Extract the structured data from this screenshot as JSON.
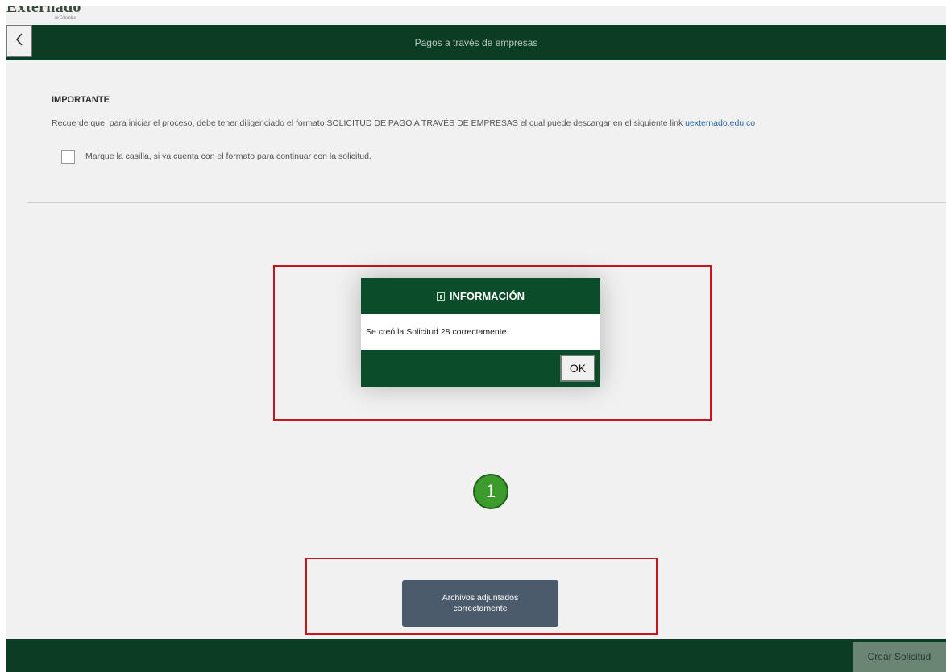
{
  "brand": {
    "name": "Externado",
    "subtitle": "de Colombia"
  },
  "header": {
    "title": "Pagos a través de empresas",
    "back_icon": "chevron-left-icon"
  },
  "content": {
    "section_title": "IMPORTANTE",
    "notice_text": "Recuerde que, para iniciar el proceso, debe tener diligenciado el formato SOLICITUD DE PAGO A TRAVÉS DE EMPRESAS el cual puede descargar en el siguiente link ",
    "notice_link": "uexternado.edu.co",
    "checkbox_label": "Marque la casilla, si ya cuenta con el formato para continuar con la solicitud.",
    "checkbox_checked": false
  },
  "dialog": {
    "title": "INFORMACIÓN",
    "icon": "info-icon",
    "message": "Se creó la Solicitud 28 correctamente",
    "ok_label": "OK"
  },
  "annotation": {
    "step_number": "1",
    "highlight_color": "#c8151b",
    "badge_color": "#3d9a2c"
  },
  "toast": {
    "message": "Archivos adjuntados correctamente"
  },
  "footer": {
    "create_label": "Crear Solicitud"
  },
  "colors": {
    "primary_green": "#0b3d24",
    "dialog_green": "#0b4d2a",
    "link": "#2b6aa8"
  }
}
